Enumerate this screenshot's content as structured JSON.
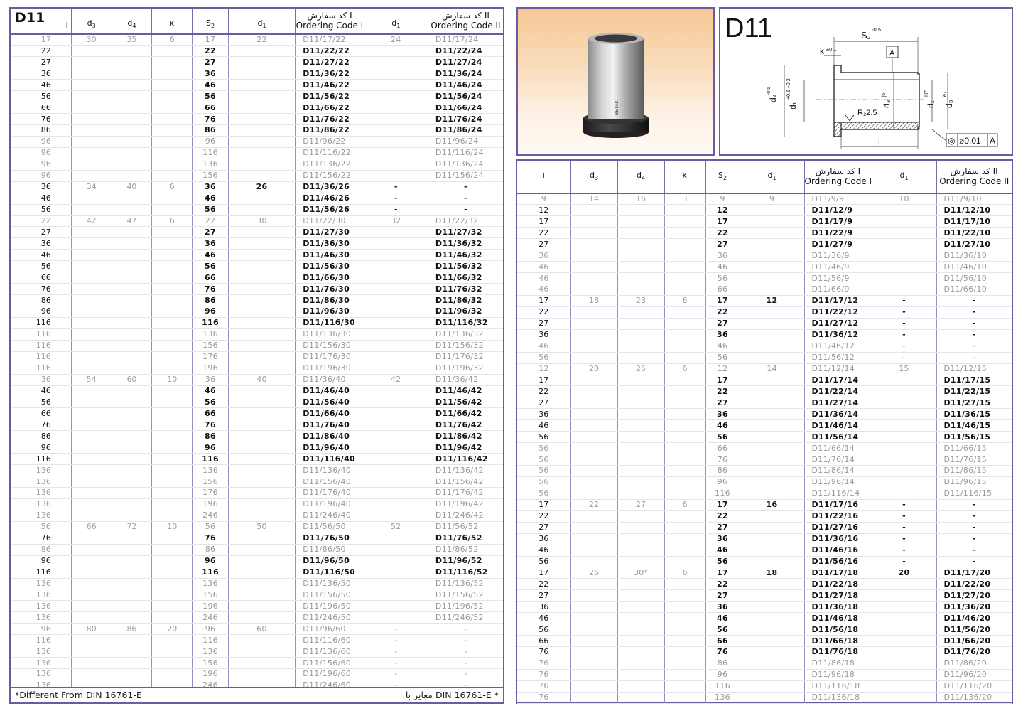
{
  "title": "D11",
  "headers": {
    "l": "l",
    "d3": "d",
    "d4": "d",
    "k": "K",
    "s2": "S",
    "d1": "d",
    "code1_fa": "کد سفارش I",
    "code1_en": "Ordering Code I",
    "d1b": "d",
    "code2_fa": "کد سفارش II",
    "code2_en": "Ordering Code II"
  },
  "footnote": {
    "left": "*Different From DIN 16761-E",
    "right": "مغایر با DIN 16761-E *"
  },
  "left_groups": [
    {
      "d3": "30",
      "d4": "35",
      "k": "6",
      "d1": "22",
      "d1b": "24",
      "code1": "D11/{s}/22",
      "code2": "D11/{s}/24",
      "rows": [
        [
          "17",
          "17",
          "g"
        ],
        [
          "22",
          "22",
          "b"
        ],
        [
          "27",
          "27",
          "b"
        ],
        [
          "36",
          "36",
          "b"
        ],
        [
          "46",
          "46",
          "b"
        ],
        [
          "56",
          "56",
          "b"
        ],
        [
          "66",
          "66",
          "b"
        ],
        [
          "76",
          "76",
          "b"
        ],
        [
          "86",
          "86",
          "b"
        ],
        [
          "96",
          "96",
          "g"
        ],
        [
          "96",
          "116",
          "g"
        ],
        [
          "96",
          "136",
          "g"
        ],
        [
          "96",
          "156",
          "g"
        ]
      ]
    },
    {
      "d3": "34",
      "d4": "40",
      "k": "6",
      "d1": "26",
      "d1b": "-",
      "code1": "D11/{s}/26",
      "code2": "-",
      "rows": [
        [
          "36",
          "36",
          "b"
        ],
        [
          "46",
          "46",
          "b"
        ],
        [
          "56",
          "56",
          "b"
        ]
      ]
    },
    {
      "d3": "42",
      "d4": "47",
      "k": "6",
      "d1": "30",
      "d1b": "32",
      "code1": "D11/{s}/30",
      "code2": "D11/{s}/32",
      "rows": [
        [
          "22",
          "22",
          "g"
        ],
        [
          "27",
          "27",
          "b"
        ],
        [
          "36",
          "36",
          "b"
        ],
        [
          "46",
          "46",
          "b"
        ],
        [
          "56",
          "56",
          "b"
        ],
        [
          "66",
          "66",
          "b"
        ],
        [
          "76",
          "76",
          "b"
        ],
        [
          "86",
          "86",
          "b"
        ],
        [
          "96",
          "96",
          "b"
        ],
        [
          "116",
          "116",
          "b"
        ],
        [
          "116",
          "136",
          "g"
        ],
        [
          "116",
          "156",
          "g"
        ],
        [
          "116",
          "176",
          "g"
        ],
        [
          "116",
          "196",
          "g"
        ]
      ]
    },
    {
      "d3": "54",
      "d4": "60",
      "k": "10",
      "d1": "40",
      "d1b": "42",
      "code1": "D11/{s}/40",
      "code2": "D11/{s}/42",
      "rows": [
        [
          "36",
          "36",
          "g"
        ],
        [
          "46",
          "46",
          "b"
        ],
        [
          "56",
          "56",
          "b"
        ],
        [
          "66",
          "66",
          "b"
        ],
        [
          "76",
          "76",
          "b"
        ],
        [
          "86",
          "86",
          "b"
        ],
        [
          "96",
          "96",
          "b"
        ],
        [
          "116",
          "116",
          "b"
        ],
        [
          "136",
          "136",
          "g"
        ],
        [
          "136",
          "156",
          "g"
        ],
        [
          "136",
          "176",
          "g"
        ],
        [
          "136",
          "196",
          "g"
        ],
        [
          "136",
          "246",
          "g"
        ]
      ]
    },
    {
      "d3": "66",
      "d4": "72",
      "k": "10",
      "d1": "50",
      "d1b": "52",
      "code1": "D11/{s}/50",
      "code2": "D11/{s}/52",
      "rows": [
        [
          "56",
          "56",
          "g"
        ],
        [
          "76",
          "76",
          "b"
        ],
        [
          "86",
          "86",
          "g"
        ],
        [
          "96",
          "96",
          "b"
        ],
        [
          "116",
          "116",
          "b"
        ],
        [
          "136",
          "136",
          "g"
        ],
        [
          "136",
          "156",
          "g"
        ],
        [
          "136",
          "196",
          "g"
        ],
        [
          "136",
          "246",
          "g"
        ]
      ]
    },
    {
      "d3": "80",
      "d4": "86",
      "k": "20",
      "d1": "60",
      "d1b": "-",
      "code1": "D11/{s}/60",
      "code2": "-",
      "rows": [
        [
          "96",
          "96",
          "g"
        ],
        [
          "116",
          "116",
          "g"
        ],
        [
          "136",
          "136",
          "g"
        ],
        [
          "136",
          "156",
          "g"
        ],
        [
          "136",
          "196",
          "g"
        ],
        [
          "136",
          "246",
          "g"
        ]
      ]
    }
  ],
  "right_groups": [
    {
      "d3": "14",
      "d4": "16",
      "k": "3",
      "d1": "9",
      "d1b": "10",
      "code1": "D11/{s}/9",
      "code2": "D11/{s}/10",
      "rows": [
        [
          "9",
          "9",
          "g"
        ],
        [
          "12",
          "12",
          "b"
        ],
        [
          "17",
          "17",
          "b"
        ],
        [
          "22",
          "22",
          "b"
        ],
        [
          "27",
          "27",
          "b"
        ],
        [
          "36",
          "36",
          "g"
        ],
        [
          "46",
          "46",
          "g"
        ],
        [
          "46",
          "56",
          "g"
        ],
        [
          "46",
          "66",
          "g"
        ]
      ]
    },
    {
      "d3": "18",
      "d4": "23",
      "k": "6",
      "d1": "12",
      "d1b": "-",
      "code1": "D11/{s}/12",
      "code2": "-",
      "rows": [
        [
          "17",
          "17",
          "b"
        ],
        [
          "22",
          "22",
          "b"
        ],
        [
          "27",
          "27",
          "b"
        ],
        [
          "36",
          "36",
          "b"
        ],
        [
          "46",
          "46",
          "g"
        ],
        [
          "56",
          "56",
          "g"
        ]
      ]
    },
    {
      "d3": "20",
      "d4": "25",
      "k": "6",
      "d1": "14",
      "d1b": "15",
      "code1": "D11/{s}/14",
      "code2": "D11/{s}/15",
      "rows": [
        [
          "12",
          "12",
          "g"
        ],
        [
          "17",
          "17",
          "b"
        ],
        [
          "22",
          "22",
          "b"
        ],
        [
          "27",
          "27",
          "b"
        ],
        [
          "36",
          "36",
          "b"
        ],
        [
          "46",
          "46",
          "b"
        ],
        [
          "56",
          "56",
          "b"
        ],
        [
          "56",
          "66",
          "g"
        ],
        [
          "56",
          "76",
          "g"
        ],
        [
          "56",
          "86",
          "g"
        ],
        [
          "56",
          "96",
          "g"
        ],
        [
          "56",
          "116",
          "g"
        ]
      ]
    },
    {
      "d3": "22",
      "d4": "27",
      "k": "6",
      "d1": "16",
      "d1b": "-",
      "code1": "D11/{s}/16",
      "code2": "-",
      "rows": [
        [
          "17",
          "17",
          "b"
        ],
        [
          "22",
          "22",
          "b"
        ],
        [
          "27",
          "27",
          "b"
        ],
        [
          "36",
          "36",
          "b"
        ],
        [
          "46",
          "46",
          "b"
        ],
        [
          "56",
          "56",
          "b"
        ]
      ]
    },
    {
      "d3": "26",
      "d4": "30*",
      "k": "6",
      "d1": "18",
      "d1b": "20",
      "code1": "D11/{s}/18",
      "code2": "D11/{s}/20",
      "rows": [
        [
          "17",
          "17",
          "b"
        ],
        [
          "22",
          "22",
          "b"
        ],
        [
          "27",
          "27",
          "b"
        ],
        [
          "36",
          "36",
          "b"
        ],
        [
          "46",
          "46",
          "b"
        ],
        [
          "56",
          "56",
          "b"
        ],
        [
          "66",
          "66",
          "b"
        ],
        [
          "76",
          "76",
          "b"
        ],
        [
          "76",
          "86",
          "g"
        ],
        [
          "76",
          "96",
          "g"
        ],
        [
          "76",
          "116",
          "g"
        ],
        [
          "76",
          "136",
          "g"
        ]
      ]
    }
  ],
  "photo": {
    "brand": "BETAK"
  },
  "drawing": {
    "title": "D11",
    "s2_label": "S₂",
    "s2_tol": "-0.5",
    "k_label": "k",
    "k_tol": "±0.1",
    "datum": "A",
    "d4_label": "d₄",
    "d4_tol": "-0.5",
    "d1a_label": "d₁",
    "d1a_tol": "+0.5 +0.2",
    "d3a_label": "d₃",
    "d3a_tol": "j6",
    "d1b_label": "d₁",
    "d1b_tol": "H7",
    "d3b_label": "d₃",
    "d3b_tol": "e7",
    "radius": "R₂2.5",
    "l_label": "l",
    "conc_sym": "◎",
    "conc_val": "ø0.01",
    "conc_ref": "A"
  },
  "colors": {
    "frame": "#6e5aa0",
    "bold": "#111111",
    "grey": "#a0a0a6"
  }
}
